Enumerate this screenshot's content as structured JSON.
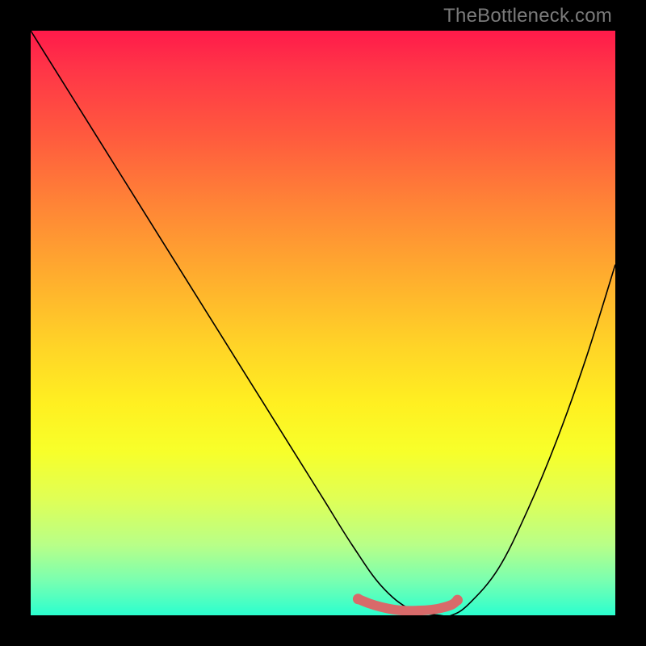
{
  "watermark": "TheBottleneck.com",
  "chart_data": {
    "type": "line",
    "title": "",
    "xlabel": "",
    "ylabel": "",
    "xlim": [
      0,
      100
    ],
    "ylim": [
      0,
      100
    ],
    "grid": false,
    "legend": false,
    "background_gradient": {
      "top_color": "#ff1a4a",
      "bottom_color": "#2bffcf",
      "meaning": "red=high bottleneck, green=low bottleneck"
    },
    "series": [
      {
        "name": "bottleneck-curve",
        "x": [
          0,
          5,
          10,
          15,
          20,
          25,
          30,
          35,
          40,
          45,
          50,
          55,
          60,
          65,
          70,
          72,
          75,
          80,
          85,
          90,
          95,
          100
        ],
        "y": [
          100,
          92,
          84,
          76,
          68,
          60,
          52,
          44,
          36,
          28,
          20,
          12,
          5,
          1,
          0,
          0,
          2,
          8,
          18,
          30,
          44,
          60
        ],
        "color": "#000000",
        "width": 1.5
      },
      {
        "name": "optimal-zone-marker",
        "x": [
          56,
          58,
          60,
          62,
          64,
          66,
          68,
          70,
          72,
          73
        ],
        "y": [
          2.8,
          2.0,
          1.4,
          1.0,
          0.8,
          0.8,
          0.9,
          1.2,
          1.8,
          2.6
        ],
        "color": "#d86a6a",
        "width": 8,
        "note": "thick salmon segment marking the bottleneck minimum"
      }
    ],
    "annotations": []
  },
  "colors": {
    "frame": "#000000",
    "curve": "#000000",
    "marker": "#d86a6a",
    "watermark": "#7a7a7a"
  }
}
